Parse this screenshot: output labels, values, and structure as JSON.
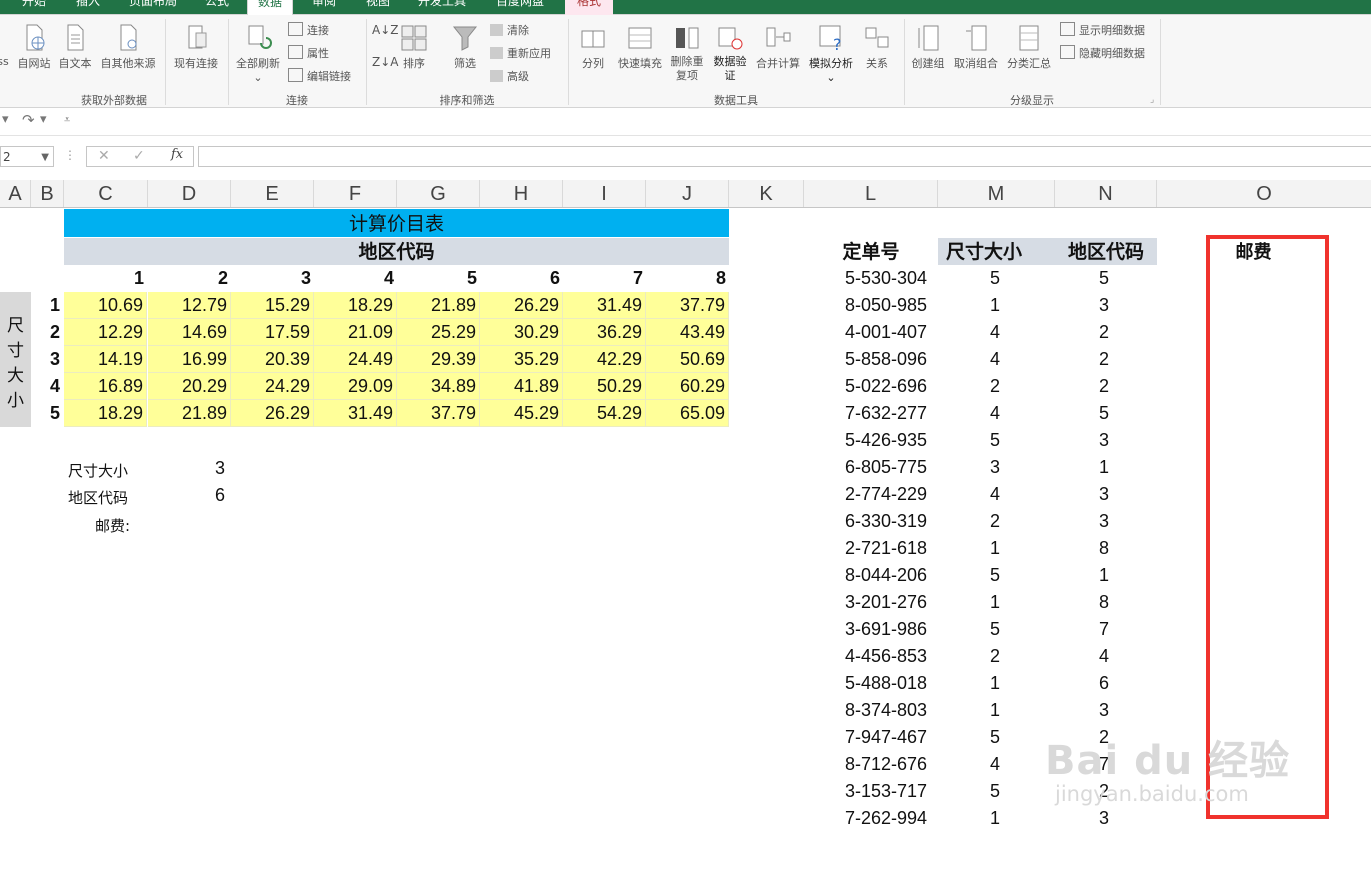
{
  "ribbon": {
    "tabs": [
      "开始",
      "插入",
      "页面布局",
      "公式",
      "数据",
      "审阅",
      "视图",
      "开发工具",
      "百度网盘",
      "格式"
    ],
    "active_tab": "数据",
    "groups": {
      "external": {
        "label": "获取外部数据",
        "buttons": [
          "ss",
          "自网站",
          "自文本",
          "自其他来源",
          "现有连接"
        ]
      },
      "connections": {
        "label": "连接",
        "refresh_all": "全部刷新",
        "small": [
          "连接",
          "属性",
          "编辑链接"
        ]
      },
      "sort_filter": {
        "label": "排序和筛选",
        "sort": "排序",
        "filter": "筛选",
        "small": [
          "清除",
          "重新应用",
          "高级"
        ]
      },
      "data_tools": {
        "label": "数据工具",
        "buttons": [
          "分列",
          "快速填充",
          "删除重复项",
          "数据验证",
          "合并计算",
          "模拟分析",
          "关系"
        ]
      },
      "outline": {
        "label": "分级显示",
        "buttons": [
          "创建组",
          "取消组合",
          "分类汇总"
        ],
        "small": [
          "显示明细数据",
          "隐藏明细数据"
        ]
      }
    }
  },
  "formula_bar": {
    "name_box": "2",
    "formula": ""
  },
  "columns": [
    "A",
    "B",
    "C",
    "D",
    "E",
    "F",
    "G",
    "H",
    "I",
    "J",
    "K",
    "L",
    "M",
    "N",
    "O"
  ],
  "price_table": {
    "title": "计算价目表",
    "region_header": "地区代码",
    "size_header": "尺寸大小",
    "region_codes": [
      "1",
      "2",
      "3",
      "4",
      "5",
      "6",
      "7",
      "8"
    ],
    "size_codes": [
      "1",
      "2",
      "3",
      "4",
      "5"
    ],
    "rows": [
      [
        "10.69",
        "12.79",
        "15.29",
        "18.29",
        "21.89",
        "26.29",
        "31.49",
        "37.79"
      ],
      [
        "12.29",
        "14.69",
        "17.59",
        "21.09",
        "25.29",
        "30.29",
        "36.29",
        "43.49"
      ],
      [
        "14.19",
        "16.99",
        "20.39",
        "24.49",
        "29.39",
        "35.29",
        "42.29",
        "50.69"
      ],
      [
        "16.89",
        "20.29",
        "24.29",
        "29.09",
        "34.89",
        "41.89",
        "50.29",
        "60.29"
      ],
      [
        "18.29",
        "21.89",
        "26.29",
        "31.49",
        "37.79",
        "45.29",
        "54.29",
        "65.09"
      ]
    ]
  },
  "lookup": {
    "size_label": "尺寸大小",
    "size_value": "3",
    "region_label": "地区代码",
    "region_value": "6",
    "postage_label": "邮费:"
  },
  "orders": {
    "headers": [
      "定单号",
      "尺寸大小",
      "地区代码",
      "邮费"
    ],
    "rows": [
      [
        "5-530-304",
        "5",
        "5"
      ],
      [
        "8-050-985",
        "1",
        "3"
      ],
      [
        "4-001-407",
        "4",
        "2"
      ],
      [
        "5-858-096",
        "4",
        "2"
      ],
      [
        "5-022-696",
        "2",
        "2"
      ],
      [
        "7-632-277",
        "4",
        "5"
      ],
      [
        "5-426-935",
        "5",
        "3"
      ],
      [
        "6-805-775",
        "3",
        "1"
      ],
      [
        "2-774-229",
        "4",
        "3"
      ],
      [
        "6-330-319",
        "2",
        "3"
      ],
      [
        "2-721-618",
        "1",
        "8"
      ],
      [
        "8-044-206",
        "5",
        "1"
      ],
      [
        "3-201-276",
        "1",
        "8"
      ],
      [
        "3-691-986",
        "5",
        "7"
      ],
      [
        "4-456-853",
        "2",
        "4"
      ],
      [
        "5-488-018",
        "1",
        "6"
      ],
      [
        "8-374-803",
        "1",
        "3"
      ],
      [
        "7-947-467",
        "5",
        "2"
      ],
      [
        "8-712-676",
        "4",
        "7"
      ],
      [
        "3-153-717",
        "5",
        "2"
      ],
      [
        "7-262-994",
        "1",
        "3"
      ]
    ]
  },
  "watermark": {
    "logo": "Bai du 经验",
    "url": "jingyan.baidu.com"
  },
  "colors": {
    "title_bar": "#00b0f0",
    "header_gray": "#d6dce4",
    "table_fill": "#ffff99",
    "highlight_border": "#f0322d",
    "ribbon_green": "#217346"
  }
}
